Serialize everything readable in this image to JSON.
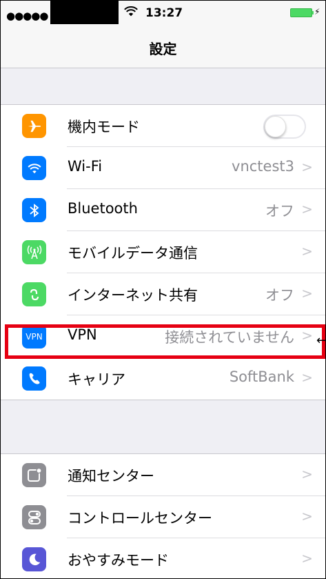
{
  "status": {
    "signal": "●●●●●",
    "time": "13:27",
    "bolt": "⚡"
  },
  "nav": {
    "title": "設定"
  },
  "colors": {
    "orange": "#ff9500",
    "blue": "#007aff",
    "green": "#4cd964",
    "gray": "#8e8e93",
    "purple": "#5856d6",
    "highlight": "#e60012"
  },
  "group1": {
    "rows": [
      {
        "label": "機内モード",
        "icon": "airplane-icon",
        "toggle_on": false
      },
      {
        "label": "Wi-Fi",
        "icon": "wifi-icon",
        "value": "vnctest3"
      },
      {
        "label": "Bluetooth",
        "icon": "bluetooth-icon",
        "value": "オフ"
      },
      {
        "label": "モバイルデータ通信",
        "icon": "cellular-icon"
      },
      {
        "label": "インターネット共有",
        "icon": "hotspot-icon",
        "value": "オフ"
      },
      {
        "label": "VPN",
        "icon": "vpn-icon",
        "icon_text": "VPN",
        "value": "接続されていません"
      },
      {
        "label": "キャリア",
        "icon": "phone-icon",
        "value": "SoftBank"
      }
    ]
  },
  "group2": {
    "rows": [
      {
        "label": "通知センター",
        "icon": "notification-center-icon"
      },
      {
        "label": "コントロールセンター",
        "icon": "control-center-icon"
      },
      {
        "label": "おやすみモード",
        "icon": "moon-icon"
      }
    ]
  }
}
